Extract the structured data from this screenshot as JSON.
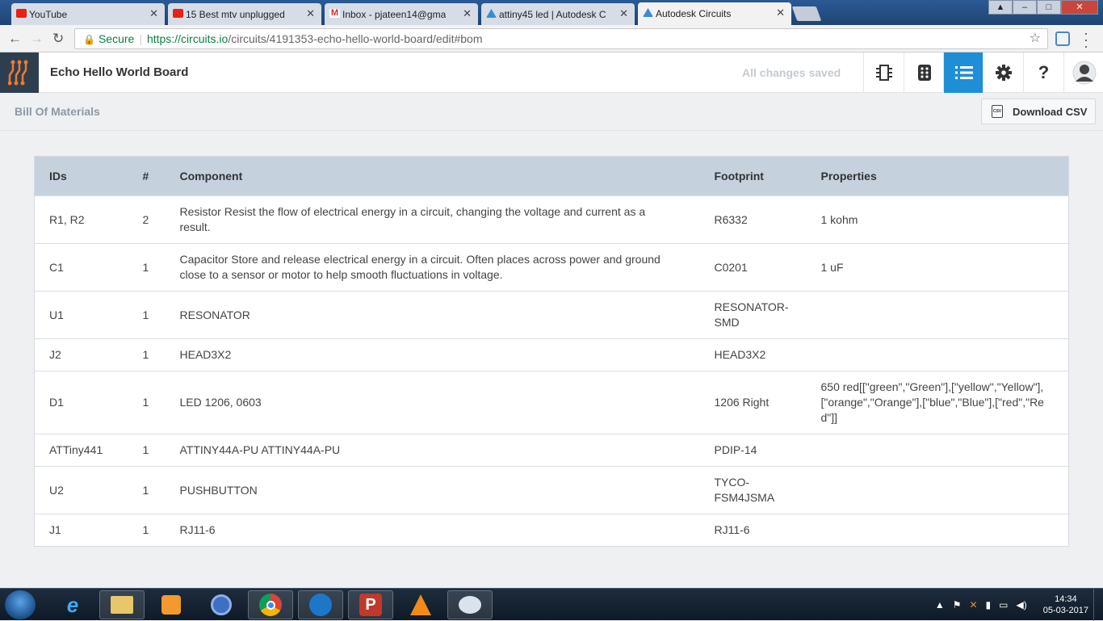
{
  "browser": {
    "tabs": [
      {
        "title": "YouTube",
        "favicon": "youtube-icon"
      },
      {
        "title": "15 Best mtv unplugged",
        "favicon": "youtube-icon"
      },
      {
        "title": "Inbox - pjateen14@gma",
        "favicon": "gmail-icon"
      },
      {
        "title": "attiny45 led | Autodesk C",
        "favicon": "autodesk-icon"
      },
      {
        "title": "Autodesk Circuits",
        "favicon": "autodesk-icon"
      }
    ],
    "secure_label": "Secure",
    "url_host": "https://circuits.io",
    "url_path": "/circuits/4191353-echo-hello-world-board/edit#bom"
  },
  "app": {
    "title": "Echo Hello World Board",
    "save_status": "All changes saved",
    "accent_color": "#1e8ed6",
    "toolbar_icons": [
      "chip-icon",
      "breadboard-icon",
      "list-icon",
      "gear-icon",
      "help-icon",
      "avatar-icon"
    ]
  },
  "bom": {
    "heading": "Bill Of Materials",
    "download_label": "Download CSV",
    "columns": [
      "IDs",
      "#",
      "Component",
      "Footprint",
      "Properties"
    ],
    "rows": [
      {
        "ids": "R1, R2",
        "count": "2",
        "component": "Resistor Resist the flow of electrical energy in a circuit, changing the voltage and current as a result.",
        "footprint": "R6332",
        "properties": "1 kohm"
      },
      {
        "ids": "C1",
        "count": "1",
        "component": "Capacitor Store and release electrical energy in a circuit. Often places across power and ground close to a sensor or motor to help smooth fluctuations in voltage.",
        "footprint": "C0201",
        "properties": "1 uF"
      },
      {
        "ids": "U1",
        "count": "1",
        "component": "RESONATOR",
        "footprint": "RESONATOR-SMD",
        "properties": ""
      },
      {
        "ids": "J2",
        "count": "1",
        "component": "HEAD3X2",
        "footprint": "HEAD3X2",
        "properties": ""
      },
      {
        "ids": "D1",
        "count": "1",
        "component": "LED 1206, 0603",
        "footprint": "1206 Right",
        "properties": "650 red[[\"green\",\"Green\"],[\"yellow\",\"Yellow\"],[\"orange\",\"Orange\"],[\"blue\",\"Blue\"],[\"red\",\"Red\"]]"
      },
      {
        "ids": "ATTiny441",
        "count": "1",
        "component": "ATTINY44A-PU ATTINY44A-PU",
        "footprint": "PDIP-14",
        "properties": ""
      },
      {
        "ids": "U2",
        "count": "1",
        "component": "PUSHBUTTON",
        "footprint": "TYCO-FSM4JSMA",
        "properties": ""
      },
      {
        "ids": "J1",
        "count": "1",
        "component": "RJ11-6",
        "footprint": "RJ11-6",
        "properties": ""
      }
    ]
  },
  "taskbar": {
    "time": "14:34",
    "date": "05-03-2017"
  }
}
